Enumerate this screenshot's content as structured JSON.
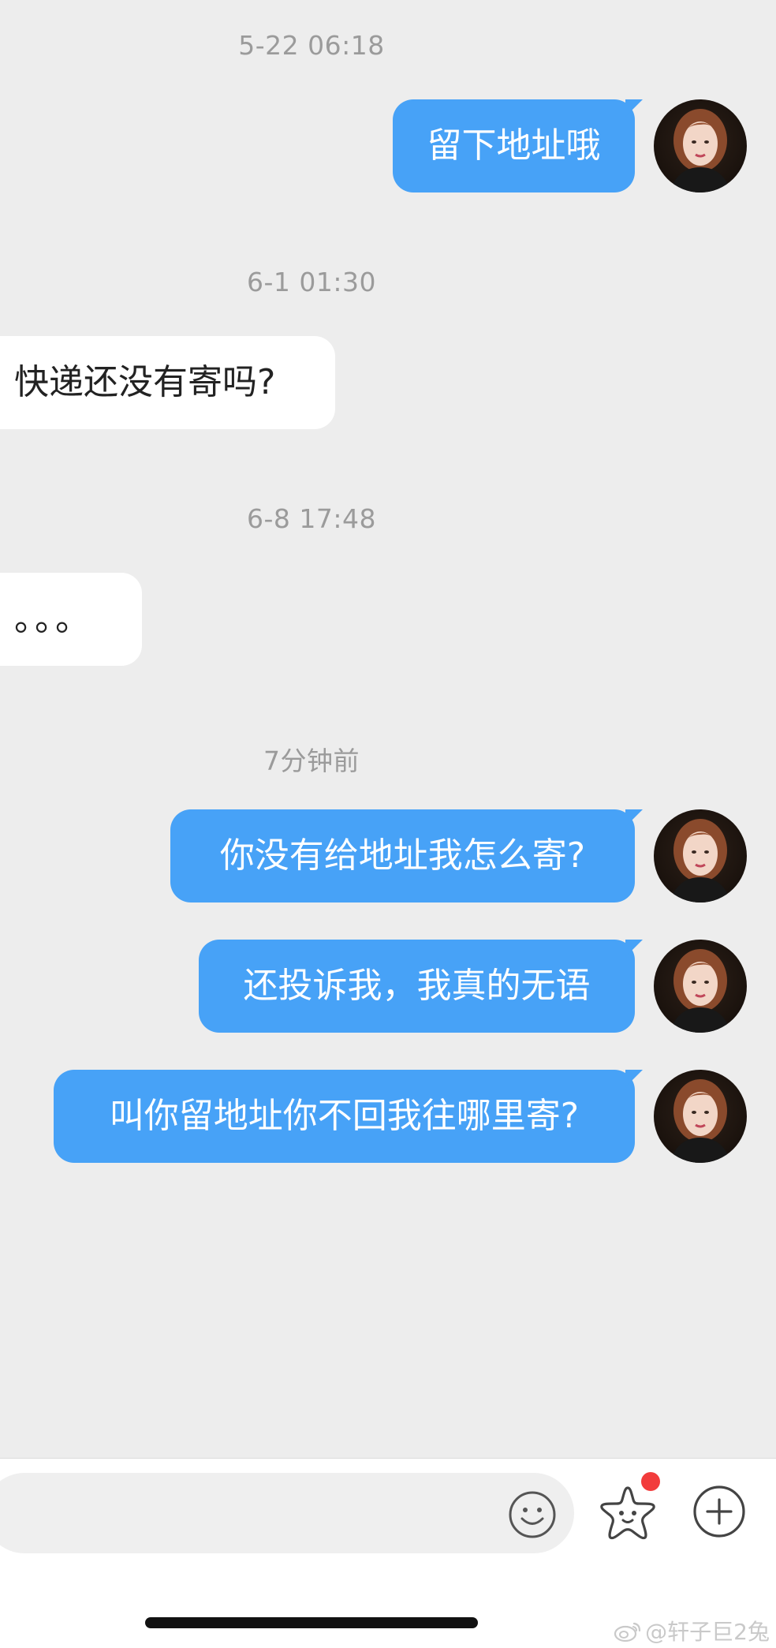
{
  "messages": [
    {
      "timestamp": "5-22 06:18",
      "text": "留下地址哦",
      "direction": "out"
    },
    {
      "timestamp": "6-1 01:30",
      "text": "快递还没有寄吗?",
      "direction": "in"
    },
    {
      "timestamp": "6-8 17:48",
      "text": "。。。",
      "direction": "in"
    },
    {
      "timestamp": "7分钟前",
      "text": "你没有给地址我怎么寄?",
      "direction": "out"
    },
    {
      "text": "还投诉我，我真的无语",
      "direction": "out"
    },
    {
      "text": "叫你留地址你不回我往哪里寄?",
      "direction": "out"
    }
  ],
  "input_bar": {
    "icons": [
      "emoji-icon",
      "star-icon",
      "plus-icon"
    ],
    "notification_dot_color": "#f23c3c"
  },
  "watermark": "@轩子巨2兔",
  "colors": {
    "outgoing_bubble": "#47a2f7",
    "incoming_bubble": "#ffffff",
    "background": "#ededed"
  }
}
